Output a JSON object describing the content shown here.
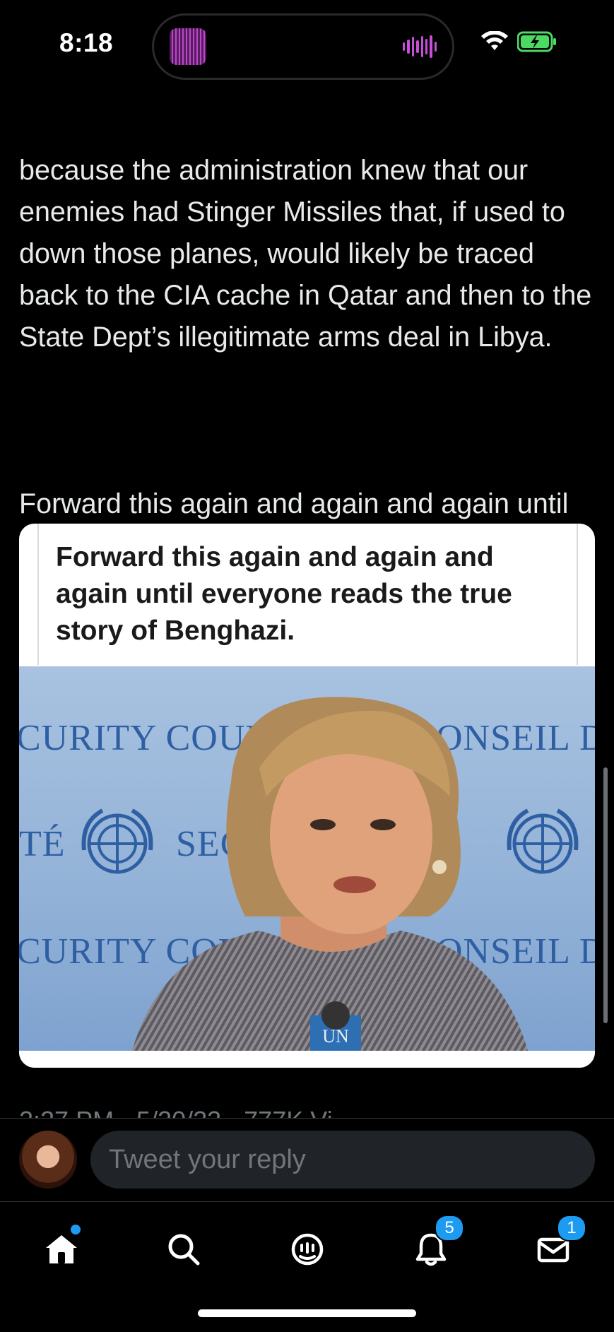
{
  "status_bar": {
    "time": "8:18"
  },
  "tweet": {
    "paragraph_1": "because the administration knew that our enemies had Stinger Missiles that, if used to down those planes, would likely be traced back to the CIA cache in Qatar and then to the State Dept’s illegitimate arms deal in Libya.",
    "paragraph_2": "Forward this again and again and again until everyone reads the true story of Benghazi.",
    "timestamp_partial": "2:27 PM · 5/30/23 · 777K Vi",
    "media": {
      "caption": "Forward this again and again and again until everyone reads the true story of Benghazi.",
      "wall_text_1": "CURITY COUNC",
      "wall_text_2": "ONSEIL DE",
      "wall_text_3": "TÉ",
      "wall_text_4": "SECU",
      "wall_text_5": "CURITY COU",
      "wall_text_6": "ONSEIL DE",
      "mic_label": "UN"
    }
  },
  "reply": {
    "placeholder": "Tweet your reply"
  },
  "tab_bar": {
    "home_icon": "home-icon",
    "search_icon": "search-icon",
    "spaces_icon": "spaces-icon",
    "notifications_icon": "bell-icon",
    "messages_icon": "mail-icon",
    "notifications_badge": "5",
    "messages_badge": "1"
  },
  "colors": {
    "background": "#000000",
    "text": "#e7e9ea",
    "accent": "#1d9bf0",
    "muted": "#71767b"
  }
}
